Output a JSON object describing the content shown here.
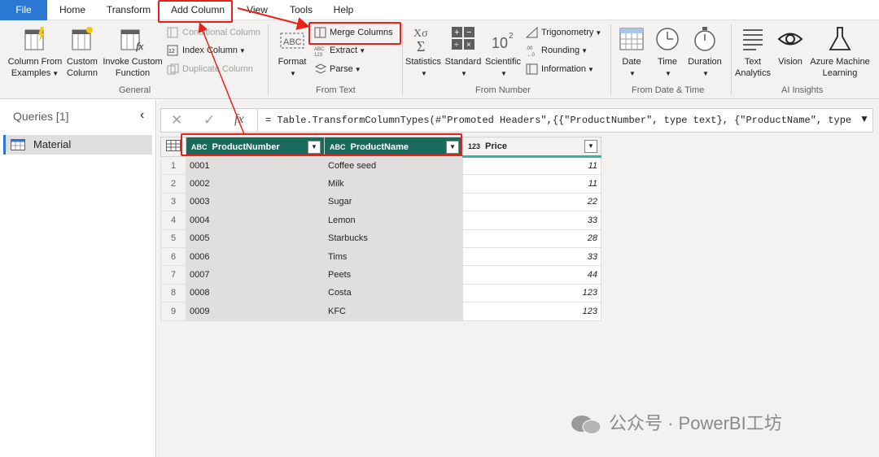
{
  "menu": {
    "items": [
      "File",
      "Home",
      "Transform",
      "Add Column",
      "View",
      "Tools",
      "Help"
    ]
  },
  "ribbon": {
    "general": {
      "column_from_examples": [
        "Column From",
        "Examples"
      ],
      "custom_column": [
        "Custom",
        "Column"
      ],
      "invoke_custom_function": [
        "Invoke Custom",
        "Function"
      ],
      "conditional_column": "Conditional Column",
      "index_column": "Index Column",
      "duplicate_column": "Duplicate Column",
      "label": "General"
    },
    "from_text": {
      "format": "Format",
      "merge_columns": "Merge Columns",
      "extract": "Extract",
      "parse": "Parse",
      "label": "From Text"
    },
    "from_number": {
      "statistics": "Statistics",
      "standard": "Standard",
      "scientific": "Scientific",
      "trigonometry": "Trigonometry",
      "rounding": "Rounding",
      "information": "Information",
      "label": "From Number"
    },
    "from_date_time": {
      "date": "Date",
      "time": "Time",
      "duration": "Duration",
      "label": "From Date & Time"
    },
    "ai_insights": {
      "text_analytics": [
        "Text",
        "Analytics"
      ],
      "vision": "Vision",
      "azure_ml": [
        "Azure Machine",
        "Learning"
      ],
      "label": "AI Insights"
    }
  },
  "queries": {
    "title": "Queries [1]",
    "items": [
      "Material"
    ]
  },
  "formula_bar": {
    "text": "= Table.TransformColumnTypes(#\"Promoted Headers\",{{\"ProductNumber\", type text}, {\"ProductName\", type"
  },
  "table": {
    "columns": [
      {
        "name": "ProductNumber",
        "type_icon": "ABC"
      },
      {
        "name": "ProductName",
        "type_icon": "ABC"
      },
      {
        "name": "Price",
        "type_icon": "123"
      }
    ],
    "rows": [
      {
        "n": "1",
        "number": "0001",
        "name": "Coffee seed",
        "price": "11"
      },
      {
        "n": "2",
        "number": "0002",
        "name": "Milk",
        "price": "11"
      },
      {
        "n": "3",
        "number": "0003",
        "name": "Sugar",
        "price": "22"
      },
      {
        "n": "4",
        "number": "0004",
        "name": "Lemon",
        "price": "33"
      },
      {
        "n": "5",
        "number": "0005",
        "name": "Starbucks",
        "price": "28"
      },
      {
        "n": "6",
        "number": "0006",
        "name": "Tims",
        "price": "33"
      },
      {
        "n": "7",
        "number": "0007",
        "name": "Peets",
        "price": "44"
      },
      {
        "n": "8",
        "number": "0008",
        "name": "Costa",
        "price": "123"
      },
      {
        "n": "9",
        "number": "0009",
        "name": "KFC",
        "price": "123"
      }
    ]
  },
  "watermark": "公众号 · PowerBI工坊",
  "colors": {
    "accent": "#2b78d4",
    "selected_header": "#196b5e",
    "annotation": "#e8221b"
  }
}
